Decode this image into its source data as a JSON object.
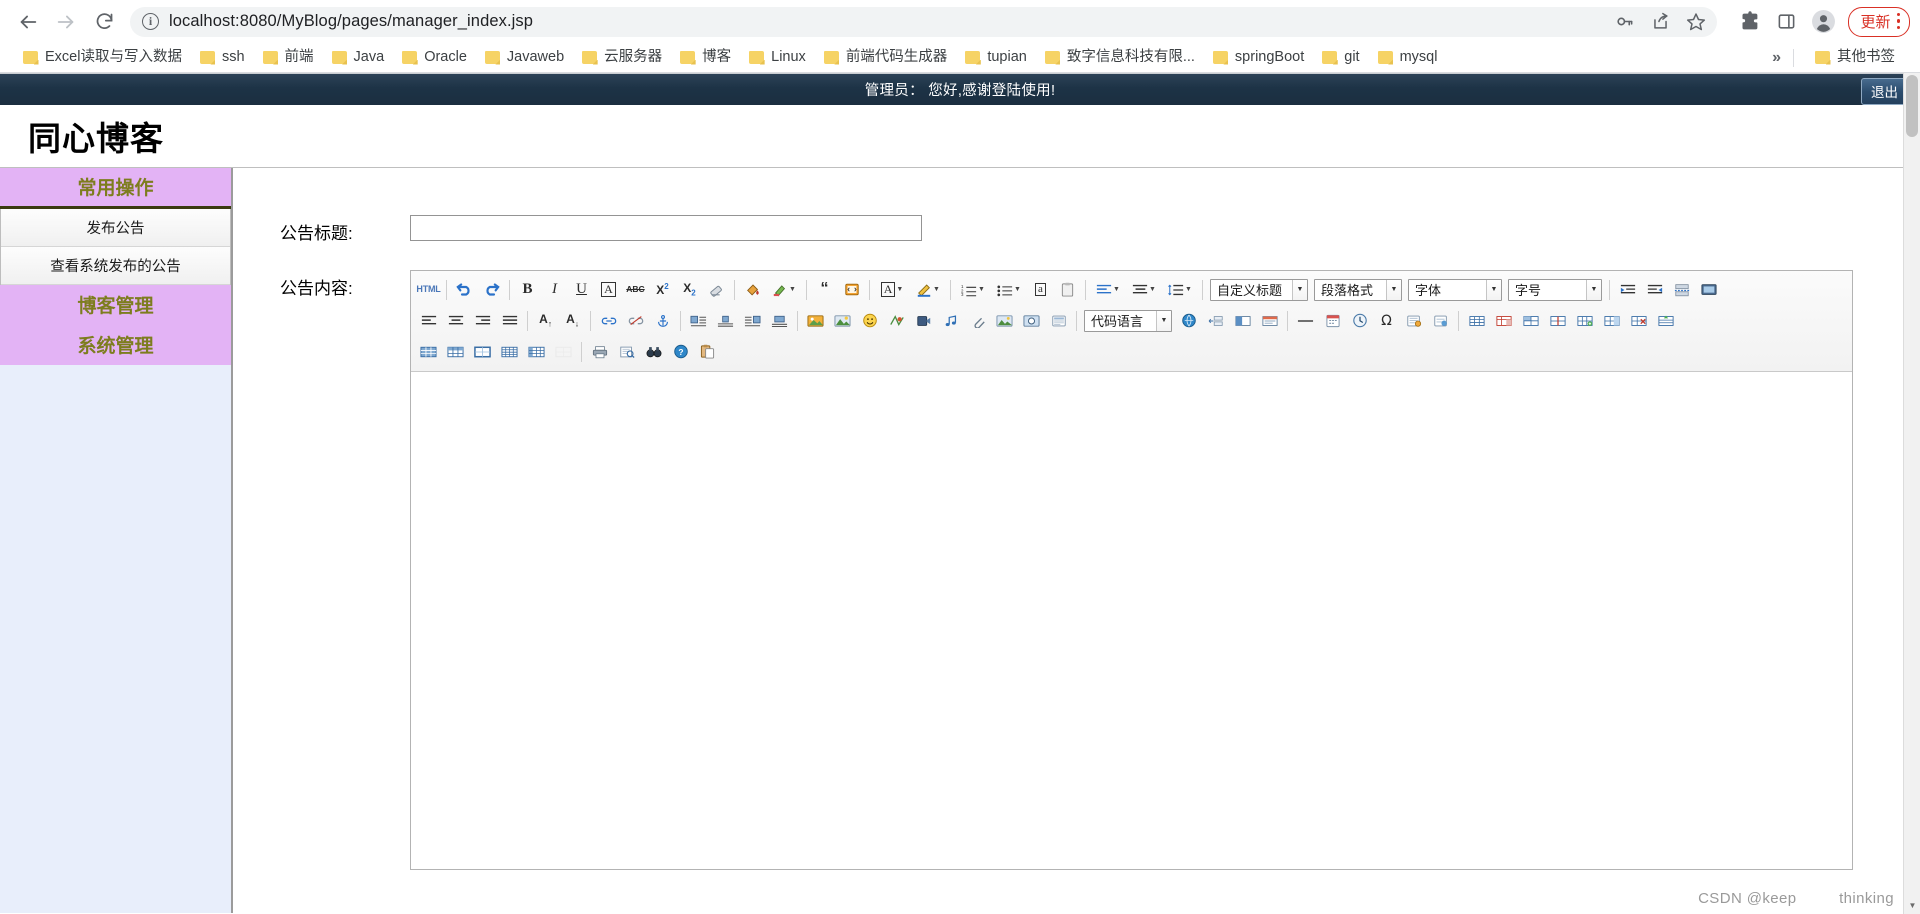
{
  "browser": {
    "nav": {
      "back_icon": "arrow-left-icon",
      "forward_icon": "arrow-right-icon",
      "reload_icon": "reload-icon"
    },
    "omnibox": {
      "site_info_icon": "info-circle-icon",
      "url": "localhost:8080/MyBlog/pages/manager_index.jsp",
      "password_icon": "key-icon",
      "share_icon": "share-icon",
      "bookmark_icon": "star-icon"
    },
    "toolbar_right": {
      "extensions_icon": "puzzle-piece-icon",
      "sidepanel_icon": "side-panel-icon",
      "profile_icon": "user-avatar-icon",
      "update_label": "更新",
      "menu_icon": "three-dot-menu-icon"
    },
    "bookmarks": [
      {
        "label": "Excel读取与写入数据"
      },
      {
        "label": "ssh"
      },
      {
        "label": "前端"
      },
      {
        "label": "Java"
      },
      {
        "label": "Oracle"
      },
      {
        "label": "Javaweb"
      },
      {
        "label": "云服务器"
      },
      {
        "label": "博客"
      },
      {
        "label": "Linux"
      },
      {
        "label": "前端代码生成器"
      },
      {
        "label": "tupian"
      },
      {
        "label": "致字信息科技有限..."
      },
      {
        "label": "springBoot"
      },
      {
        "label": "git"
      },
      {
        "label": "mysql"
      }
    ],
    "bookmarks_overflow": {
      "chevron_label": "»",
      "other_bookmarks_label": "其他书签"
    }
  },
  "admin_bar": {
    "greeting": "管理员： 您好,感谢登陆使用!",
    "logout_label": "退出",
    "background_color": "#1d3346"
  },
  "site": {
    "title": "同心博客"
  },
  "sidebar": {
    "background_color": "#e8eefb",
    "header_color": "#e3b3f5",
    "header_text_color": "#7d7d1e",
    "sections": [
      {
        "title": "常用操作",
        "items": [
          {
            "label": "发布公告"
          },
          {
            "label": "查看系统发布的公告"
          }
        ]
      },
      {
        "title": "博客管理",
        "items": []
      },
      {
        "title": "系统管理",
        "items": []
      }
    ]
  },
  "form": {
    "title_label": "公告标题:",
    "title_value": "",
    "title_placeholder": "",
    "content_label": "公告内容:",
    "content_value": ""
  },
  "editor": {
    "rows": [
      [
        {
          "type": "button",
          "name": "source-html-button",
          "glyph": "HTML",
          "style": "html"
        },
        {
          "type": "sep"
        },
        {
          "type": "button",
          "name": "undo-button",
          "glyph": "↶",
          "style": "blue"
        },
        {
          "type": "button",
          "name": "redo-button",
          "glyph": "↷",
          "style": "blue"
        },
        {
          "type": "sep"
        },
        {
          "type": "button",
          "name": "bold-button",
          "glyph": "B"
        },
        {
          "type": "button",
          "name": "italic-button",
          "glyph": "I"
        },
        {
          "type": "button",
          "name": "underline-button",
          "glyph": "U"
        },
        {
          "type": "button",
          "name": "text-border-button",
          "glyph": "A"
        },
        {
          "type": "button",
          "name": "strikethrough-button",
          "glyph": "ABC"
        },
        {
          "type": "button",
          "name": "superscript-button",
          "glyph": "X²"
        },
        {
          "type": "button",
          "name": "subscript-button",
          "glyph": "X₂"
        },
        {
          "type": "button",
          "name": "remove-format-button",
          "glyph": "eraser"
        },
        {
          "type": "sep"
        },
        {
          "type": "button",
          "name": "background-color-button",
          "glyph": "paint"
        },
        {
          "type": "button",
          "name": "highlight-color-button",
          "glyph": "brush",
          "dropdown": true
        },
        {
          "type": "sep"
        },
        {
          "type": "button",
          "name": "blockquote-button",
          "glyph": "❝"
        },
        {
          "type": "button",
          "name": "insert-code-button",
          "glyph": "code"
        },
        {
          "type": "sep"
        },
        {
          "type": "button",
          "name": "font-color-button",
          "glyph": "A",
          "dropdown": true
        },
        {
          "type": "button",
          "name": "back-color-button",
          "glyph": "pen",
          "dropdown": true
        },
        {
          "type": "sep"
        },
        {
          "type": "button",
          "name": "ordered-list-button",
          "glyph": "list-num",
          "dropdown": true
        },
        {
          "type": "button",
          "name": "unordered-list-button",
          "glyph": "list-dot",
          "dropdown": true
        },
        {
          "type": "button",
          "name": "anchor-link-button",
          "glyph": "a"
        },
        {
          "type": "button",
          "name": "paste-plain-button",
          "glyph": "clipboard"
        },
        {
          "type": "sep"
        },
        {
          "type": "button",
          "name": "align-button",
          "glyph": "align",
          "dropdown": true
        },
        {
          "type": "button",
          "name": "paragraph-align-button",
          "glyph": "align2",
          "dropdown": true
        },
        {
          "type": "button",
          "name": "line-height-button",
          "glyph": "lineheight",
          "dropdown": true
        },
        {
          "type": "sep"
        },
        {
          "type": "select",
          "name": "custom-heading-select",
          "label": "自定义标题",
          "width": "w1"
        },
        {
          "type": "select",
          "name": "paragraph-format-select",
          "label": "段落格式",
          "width": "w2"
        },
        {
          "type": "select",
          "name": "font-family-select",
          "label": "字体",
          "width": "w3"
        },
        {
          "type": "select",
          "name": "font-size-select",
          "label": "字号",
          "width": "w4"
        },
        {
          "type": "sep"
        },
        {
          "type": "button",
          "name": "indent-right-button",
          "glyph": "ind-r"
        },
        {
          "type": "button",
          "name": "indent-left-button",
          "glyph": "ind-l"
        },
        {
          "type": "button",
          "name": "page-break-button",
          "glyph": "pagebreak"
        },
        {
          "type": "button",
          "name": "fullscreen-button",
          "glyph": "screen"
        }
      ],
      [
        {
          "type": "button",
          "name": "align-left-button",
          "glyph": "al"
        },
        {
          "type": "button",
          "name": "align-center-button",
          "glyph": "ac"
        },
        {
          "type": "button",
          "name": "align-right-button",
          "glyph": "ar"
        },
        {
          "type": "button",
          "name": "align-justify-button",
          "glyph": "aj"
        },
        {
          "type": "sep"
        },
        {
          "type": "button",
          "name": "increase-font-button",
          "glyph": "A↑"
        },
        {
          "type": "button",
          "name": "decrease-font-button",
          "glyph": "A↓"
        },
        {
          "type": "sep"
        },
        {
          "type": "button",
          "name": "insert-link-button",
          "glyph": "link"
        },
        {
          "type": "button",
          "name": "unlink-button",
          "glyph": "unlink"
        },
        {
          "type": "button",
          "name": "anchor-button",
          "glyph": "anchor"
        },
        {
          "type": "sep"
        },
        {
          "type": "button",
          "name": "image-left-button",
          "glyph": "iml"
        },
        {
          "type": "button",
          "name": "image-center-button",
          "glyph": "imc"
        },
        {
          "type": "button",
          "name": "image-right-button",
          "glyph": "imr"
        },
        {
          "type": "button",
          "name": "image-none-button",
          "glyph": "imn"
        },
        {
          "type": "sep"
        },
        {
          "type": "button",
          "name": "insert-image-button",
          "glyph": "picture"
        },
        {
          "type": "button",
          "name": "image-gallery-button",
          "glyph": "gallery"
        },
        {
          "type": "button",
          "name": "emoticon-button",
          "glyph": "smile"
        },
        {
          "type": "button",
          "name": "map-button",
          "glyph": "map"
        },
        {
          "type": "button",
          "name": "video-button",
          "glyph": "video"
        },
        {
          "type": "button",
          "name": "music-button",
          "glyph": "music"
        },
        {
          "type": "button",
          "name": "attachment-button",
          "glyph": "attach"
        },
        {
          "type": "button",
          "name": "web-app-button",
          "glyph": "webapp"
        },
        {
          "type": "button",
          "name": "screenshot-button",
          "glyph": "shot"
        },
        {
          "type": "button",
          "name": "template-button",
          "glyph": "template"
        },
        {
          "type": "sep"
        },
        {
          "type": "select",
          "name": "code-language-select",
          "label": "代码语言",
          "width": "wcode"
        },
        {
          "type": "button",
          "name": "spell-check-button",
          "glyph": "spell"
        },
        {
          "type": "button",
          "name": "insert-form-button",
          "glyph": "form"
        },
        {
          "type": "button",
          "name": "split-view-button",
          "glyph": "split"
        },
        {
          "type": "button",
          "name": "compare-button",
          "glyph": "compare"
        },
        {
          "type": "sep"
        },
        {
          "type": "button",
          "name": "horizontal-rule-button",
          "glyph": "hr"
        },
        {
          "type": "button",
          "name": "date-button",
          "glyph": "date"
        },
        {
          "type": "button",
          "name": "time-button",
          "glyph": "time"
        },
        {
          "type": "button",
          "name": "special-char-button",
          "glyph": "Ω"
        },
        {
          "type": "button",
          "name": "insert-page-button",
          "glyph": "page"
        },
        {
          "type": "button",
          "name": "seo-button",
          "glyph": "seo"
        },
        {
          "type": "sep"
        },
        {
          "type": "button",
          "name": "insert-table-button",
          "glyph": "tbl"
        },
        {
          "type": "button",
          "name": "table-props-button",
          "glyph": "tblp"
        },
        {
          "type": "button",
          "name": "merge-cells-button",
          "glyph": "tblm"
        },
        {
          "type": "button",
          "name": "split-cells-button",
          "glyph": "tbls"
        },
        {
          "type": "button",
          "name": "insert-row-button",
          "glyph": "tblr"
        },
        {
          "type": "button",
          "name": "insert-col-button",
          "glyph": "tblc"
        },
        {
          "type": "button",
          "name": "delete-row-button",
          "glyph": "tbld"
        },
        {
          "type": "button",
          "name": "table-sort-button",
          "glyph": "tblt"
        }
      ],
      [
        {
          "type": "button",
          "name": "table-cell-bg-button",
          "glyph": "tc1"
        },
        {
          "type": "button",
          "name": "table-cell-align-button",
          "glyph": "tc2"
        },
        {
          "type": "button",
          "name": "table-border-button",
          "glyph": "tc3"
        },
        {
          "type": "button",
          "name": "table-grid-button",
          "glyph": "tc4"
        },
        {
          "type": "button",
          "name": "table-style-button",
          "glyph": "tc5"
        },
        {
          "type": "button",
          "name": "table-delete-button",
          "glyph": "tc6",
          "disabled": true
        },
        {
          "type": "sep"
        },
        {
          "type": "button",
          "name": "print-button",
          "glyph": "print"
        },
        {
          "type": "button",
          "name": "preview-button",
          "glyph": "preview"
        },
        {
          "type": "button",
          "name": "search-replace-button",
          "glyph": "binoc"
        },
        {
          "type": "button",
          "name": "help-button",
          "glyph": "help"
        },
        {
          "type": "button",
          "name": "paste-button",
          "glyph": "paste"
        }
      ]
    ]
  },
  "watermark": {
    "left_text": "CSDN @keep",
    "right_text": "thinking"
  }
}
